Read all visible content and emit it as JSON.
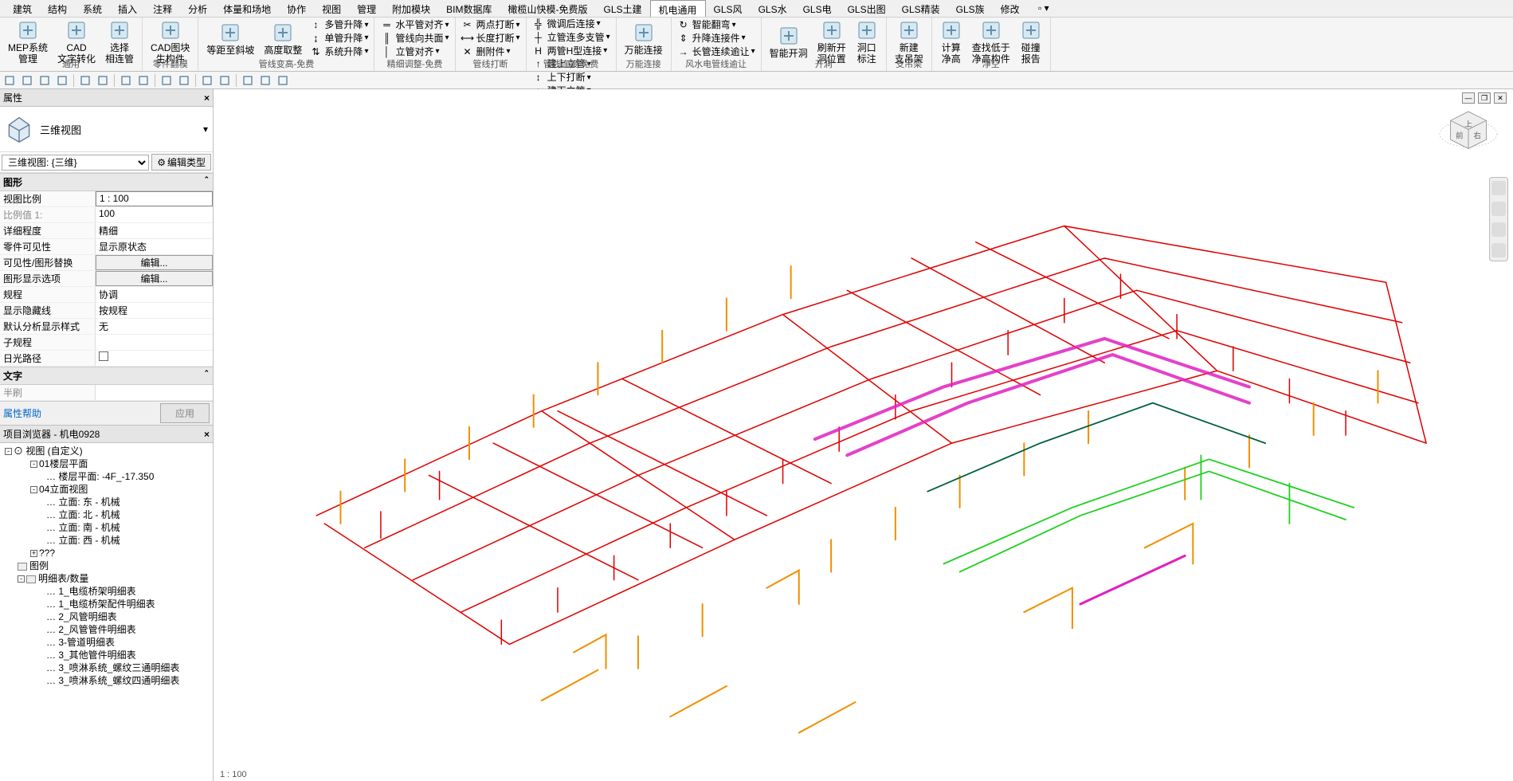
{
  "menu": {
    "items": [
      "建筑",
      "结构",
      "系统",
      "插入",
      "注释",
      "分析",
      "体量和场地",
      "协作",
      "视图",
      "管理",
      "附加模块",
      "BIM数据库",
      "橄榄山快模-免费版",
      "GLS土建",
      "机电通用",
      "GLS风",
      "GLS水",
      "GLS电",
      "GLS出图",
      "GLS精装",
      "GLS族",
      "修改"
    ],
    "active_index": 14
  },
  "ribbon": {
    "groups": [
      {
        "label": "通用",
        "buttons": [
          {
            "name": "mep-sys",
            "label": "MEP系统\n管理",
            "big": true
          },
          {
            "name": "cad-text",
            "label": "CAD\n文字转化",
            "big": true
          },
          {
            "name": "sel-link",
            "label": "选择\n相连管",
            "big": true
          }
        ]
      },
      {
        "label": "零件翻模",
        "buttons": [
          {
            "name": "cad-block",
            "label": "CAD图块\n生构件",
            "big": true
          }
        ]
      },
      {
        "label": "管线变高-免费",
        "buttons": [
          {
            "name": "eq-slope",
            "label": "等距至斜坡",
            "big": true
          },
          {
            "name": "height",
            "label": "高度取整",
            "big": true
          },
          {
            "name": "multi-lift",
            "label": "多管升降",
            "sm": true,
            "icon": "↕"
          },
          {
            "name": "single-lift",
            "label": "单管升降",
            "sm": true,
            "icon": "↨"
          },
          {
            "name": "sys-lift",
            "label": "系统升降",
            "sm": true,
            "icon": "⇅"
          }
        ]
      },
      {
        "label": "精细调整-免费",
        "buttons": [
          {
            "name": "h-align",
            "label": "水平管对齐",
            "sm": true,
            "icon": "═"
          },
          {
            "name": "vert-align",
            "label": "管线向共面",
            "sm": true,
            "icon": "║"
          },
          {
            "name": "v-align",
            "label": "立管对齐",
            "sm": true,
            "icon": "│"
          }
        ]
      },
      {
        "label": "管线打断",
        "buttons": [
          {
            "name": "2pt-br",
            "label": "两点打断",
            "sm": true,
            "icon": "✂"
          },
          {
            "name": "len-br",
            "label": "长度打断",
            "sm": true,
            "icon": "⟷"
          },
          {
            "name": "del-att",
            "label": "删附件",
            "sm": true,
            "icon": "✕"
          }
        ]
      },
      {
        "label": "管线连接-免费",
        "buttons": [
          {
            "name": "fine-conn",
            "label": "微调后连接",
            "sm": true,
            "icon": "╬"
          },
          {
            "name": "multi-br",
            "label": "立管连多支管",
            "sm": true,
            "icon": "┼"
          },
          {
            "name": "two-h",
            "label": "两管H型连接",
            "sm": true,
            "icon": "H"
          },
          {
            "name": "build-v",
            "label": "建上立管",
            "sm": true,
            "icon": "↑"
          },
          {
            "name": "updown-v",
            "label": "上下打断",
            "sm": true,
            "icon": "↕"
          },
          {
            "name": "build-v2",
            "label": "建下立管",
            "sm": true,
            "icon": "↓"
          }
        ]
      },
      {
        "label": "万能连接",
        "buttons": [
          {
            "name": "univ-conn",
            "label": "万能连接",
            "big": true
          }
        ]
      },
      {
        "label": "风水电管线逾让",
        "buttons": [
          {
            "name": "smart-flip",
            "label": "智能翻弯",
            "sm": true,
            "icon": "↻"
          },
          {
            "name": "lift-conn",
            "label": "升降连接件",
            "sm": true,
            "icon": "⇕"
          },
          {
            "name": "long-cont",
            "label": "长管连续逾让",
            "sm": true,
            "icon": "→"
          }
        ]
      },
      {
        "label": "开洞",
        "buttons": [
          {
            "name": "smart-hole",
            "label": "智能开洞",
            "big": true
          },
          {
            "name": "refresh",
            "label": "刷新开\n洞位置",
            "big": true
          },
          {
            "name": "hole-tag",
            "label": "洞口\n标注",
            "big": true
          }
        ]
      },
      {
        "label": "支吊架",
        "buttons": [
          {
            "name": "new-hanger",
            "label": "新建\n支吊架",
            "big": true
          }
        ]
      },
      {
        "label": "净空",
        "buttons": [
          {
            "name": "calc-h",
            "label": "计算\n净高",
            "big": true
          },
          {
            "name": "find-low",
            "label": "查找低于\n净高构件",
            "big": true
          },
          {
            "name": "clash",
            "label": "碰撞\n报告",
            "big": true
          }
        ]
      }
    ]
  },
  "qat": {
    "items": [
      "open",
      "save",
      "undo",
      "redo",
      "sep",
      "measure",
      "select",
      "sep",
      "dim",
      "arc",
      "sep",
      "tag",
      "section",
      "sep",
      "filter",
      "grid",
      "sep",
      "crop",
      "box",
      "hide"
    ]
  },
  "properties": {
    "title": "属性",
    "type_name": "三维视图",
    "selector": "三维视图: {三维}",
    "edit_type": "编辑类型",
    "categories": [
      {
        "name": "图形",
        "rows": [
          {
            "label": "视图比例",
            "val": "1 : 100",
            "boxed": true
          },
          {
            "label": "比例值 1:",
            "val": "100",
            "dim": true
          },
          {
            "label": "详细程度",
            "val": "精细"
          },
          {
            "label": "零件可见性",
            "val": "显示原状态"
          },
          {
            "label": "可见性/图形替换",
            "val": "编辑...",
            "btn": true
          },
          {
            "label": "图形显示选项",
            "val": "编辑...",
            "btn": true
          },
          {
            "label": "规程",
            "val": "协调"
          },
          {
            "label": "显示隐藏线",
            "val": "按规程"
          },
          {
            "label": "默认分析显示样式",
            "val": "无"
          },
          {
            "label": "子规程",
            "val": ""
          },
          {
            "label": "日光路径",
            "val": "",
            "check": true
          }
        ]
      },
      {
        "name": "文字",
        "rows": []
      }
    ],
    "extra_label": "半刷",
    "help_link": "属性帮助",
    "apply": "应用"
  },
  "browser": {
    "title": "项目浏览器 - 机电0928",
    "root": "视图 (自定义)",
    "tree": [
      {
        "level": 1,
        "exp": "-",
        "text": "01楼层平面"
      },
      {
        "level": 2,
        "leaf": true,
        "text": "楼层平面: -4F_-17.350"
      },
      {
        "level": 1,
        "exp": "-",
        "text": "04立面视图"
      },
      {
        "level": 2,
        "leaf": true,
        "text": "立面: 东 - 机械"
      },
      {
        "level": 2,
        "leaf": true,
        "text": "立面: 北 - 机械"
      },
      {
        "level": 2,
        "leaf": true,
        "text": "立面: 南 - 机械"
      },
      {
        "level": 2,
        "leaf": true,
        "text": "立面: 西 - 机械"
      },
      {
        "level": 1,
        "exp": "+",
        "text": "???"
      },
      {
        "level": 0,
        "exp": "",
        "icon": true,
        "text": "图例"
      },
      {
        "level": 0,
        "exp": "-",
        "icon": true,
        "text": "明细表/数量"
      },
      {
        "level": 2,
        "leaf": true,
        "text": "1_电缆桥架明细表"
      },
      {
        "level": 2,
        "leaf": true,
        "text": "1_电缆桥架配件明细表"
      },
      {
        "level": 2,
        "leaf": true,
        "text": "2_风管明细表"
      },
      {
        "level": 2,
        "leaf": true,
        "text": "2_风管管件明细表"
      },
      {
        "level": 2,
        "leaf": true,
        "text": "3-管道明细表"
      },
      {
        "level": 2,
        "leaf": true,
        "text": "3_其他管件明细表"
      },
      {
        "level": 2,
        "leaf": true,
        "text": "3_喷淋系统_螺纹三通明细表"
      },
      {
        "level": 2,
        "leaf": true,
        "text": "3_喷淋系统_螺纹四通明细表"
      }
    ]
  },
  "statusbar": {
    "scale": "1 : 100"
  }
}
